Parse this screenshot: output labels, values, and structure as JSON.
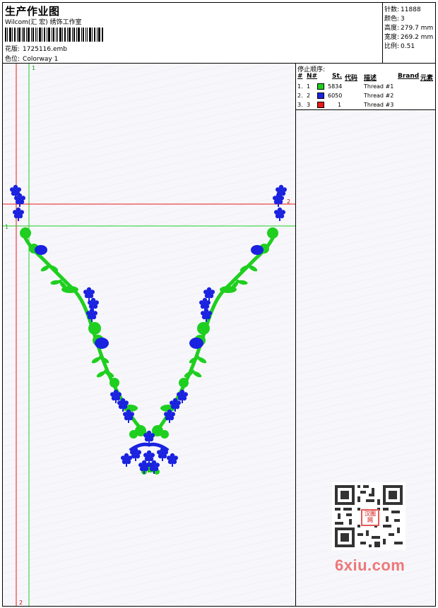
{
  "header": {
    "title": "生产作业图",
    "studio": "Wilcom(汇 宏) 绣饰工作室",
    "file_label": "花版:",
    "file_name": "1725116.emb",
    "colorway_label": "色位:",
    "colorway_name": "Colorway 1"
  },
  "stats": {
    "stitches_label": "针数:",
    "stitches": "11888",
    "colors_label": "颜色:",
    "colors": "3",
    "height_label": "高度:",
    "height": "279.7 mm",
    "width_label": "宽度:",
    "width": "269.2 mm",
    "scale_label": "比例:",
    "scale": "0.51"
  },
  "guides": {
    "green_vertical_label": "1",
    "green_horizontal_label": "1",
    "red_vertical_label": "2",
    "red_horizontal_label": "2"
  },
  "stop_sequence": {
    "title": "停止顺序:",
    "headers": {
      "num": "#",
      "n": "N#",
      "st": "St.",
      "code": "代码",
      "desc": "描述",
      "brand": "Brand",
      "element": "元素"
    },
    "rows": [
      {
        "num": "1.",
        "n": "1",
        "color": "#1fcf1f",
        "code": "5834",
        "desc": "Thread #1"
      },
      {
        "num": "2.",
        "n": "2",
        "color": "#1a22e0",
        "code": "6050",
        "desc": "Thread #2"
      },
      {
        "num": "3.",
        "n": "3",
        "color": "#e81a1a",
        "code": "1",
        "desc": "Thread #3"
      }
    ]
  },
  "qr": {
    "stamp_text": "汉图网"
  },
  "watermark": "6xiu.com",
  "colors": {
    "green_thread": "#1fcf1f",
    "blue_thread": "#1a22e0",
    "red_guide": "#e81a1a",
    "green_guide": "#22cc22"
  }
}
